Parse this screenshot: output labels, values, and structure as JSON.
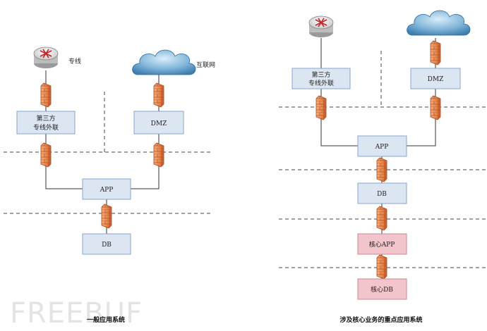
{
  "left": {
    "router_label": "专线",
    "cloud_label": "互联网",
    "third_party": [
      "第三方",
      "专线外联"
    ],
    "dmz": "DMZ",
    "app": "APP",
    "db": "DB",
    "caption": "一般应用系统"
  },
  "right": {
    "third_party": [
      "第三方",
      "专线外联"
    ],
    "dmz": "DMZ",
    "app": "APP",
    "db": "DB",
    "core_app": "核心APP",
    "core_db": "核心DB",
    "caption": "涉及核心业务的重点应用系统"
  },
  "watermark": "FREEBUF",
  "colors": {
    "box_fill": "#dce6f2",
    "core_fill": "#f2c4cc",
    "firewall": "#e8864a"
  }
}
